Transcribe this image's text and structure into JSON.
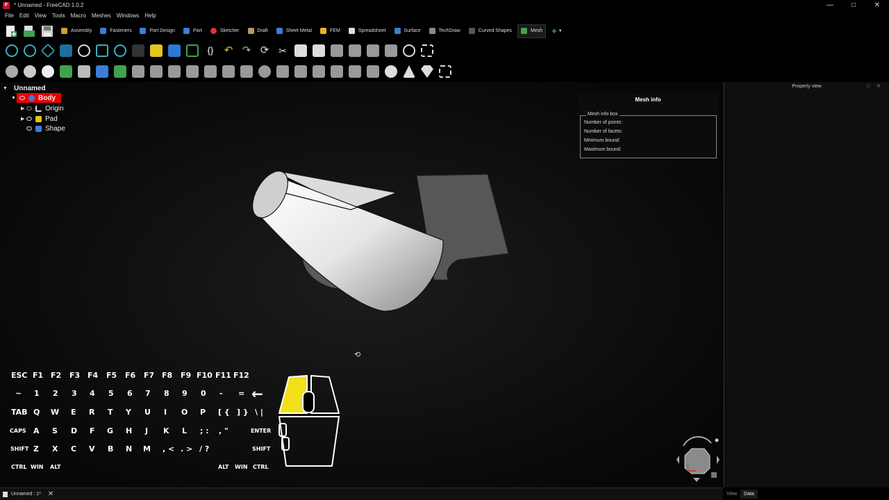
{
  "window": {
    "title": "* Unnamed - FreeCAD 1.0.2",
    "controls": [
      "—",
      "□",
      "✕"
    ]
  },
  "menu": [
    "File",
    "Edit",
    "View",
    "Tools",
    "Macro",
    "Meshes",
    "Windows",
    "Help"
  ],
  "workbenches": [
    {
      "label": "Assembly",
      "color": "#c9a227"
    },
    {
      "label": "Fasteners",
      "color": "#3b7dd8"
    },
    {
      "label": "Part Design",
      "color": "#3b7dd8"
    },
    {
      "label": "Part",
      "color": "#3b7dd8"
    },
    {
      "label": "Sketcher",
      "color": "#d33"
    },
    {
      "label": "Draft",
      "color": "#b89660"
    },
    {
      "label": "Sheet Metal",
      "color": "#3b7dd8"
    },
    {
      "label": "FEM",
      "color": "#e6b422"
    },
    {
      "label": "Spreadsheet",
      "color": "#ddd"
    },
    {
      "label": "Surface",
      "color": "#3b7dd8"
    },
    {
      "label": "TechDraw",
      "color": "#888"
    },
    {
      "label": "Curved Shapes",
      "color": "#555"
    },
    {
      "label": "Mesh",
      "color": "#3fa34d"
    }
  ],
  "active_workbench": "Mesh",
  "add_workbench_icon": "plus-icon",
  "tree": {
    "root": "Unnamed",
    "items": [
      {
        "label": "Body",
        "icon": "body-icon",
        "selected": true
      },
      {
        "label": "Origin",
        "icon": "origin-icon"
      },
      {
        "label": "Pad",
        "icon": "pad-icon"
      },
      {
        "label": "Shape",
        "icon": "shape-icon"
      }
    ]
  },
  "mesh_info": {
    "title": "Mesh info",
    "box_title": "Mesh info box",
    "lines": [
      "Number of points:",
      "Number of facets:",
      "Minimum bound:",
      "Maximum bound:"
    ]
  },
  "property_view": {
    "title": "Property view",
    "tabs": [
      "View",
      "Data"
    ],
    "active_tab": "Data"
  },
  "status": {
    "doc_tab": "Unnamed : 1*"
  },
  "keyboard": {
    "rows": [
      [
        "ESC",
        "F1",
        "F2",
        "F3",
        "F4",
        "F5",
        "F6",
        "F7",
        "F8",
        "F9",
        "F10",
        "F11",
        "F12"
      ],
      [
        "~",
        "1",
        "2",
        "3",
        "4",
        "5",
        "6",
        "7",
        "8",
        "9",
        "0",
        "-",
        "=",
        "←"
      ],
      [
        "TAB",
        "Q",
        "W",
        "E",
        "R",
        "T",
        "Y",
        "U",
        "I",
        "O",
        "P",
        "[ {",
        "] }",
        "\\ |"
      ],
      [
        "CAPS",
        "A",
        "S",
        "D",
        "F",
        "G",
        "H",
        "J",
        "K",
        "L",
        "; :",
        ", \""
      ],
      [
        "SHIFT",
        "Z",
        "X",
        "C",
        "V",
        "B",
        "N",
        "M",
        ", <",
        ". >",
        "/ ?",
        "SHIFT"
      ],
      [
        "CTRL",
        "WIN",
        "ALT",
        "ALT",
        "WIN",
        "CTRL"
      ]
    ],
    "enter": "ENTER",
    "highlight_color": "#f2e01a"
  },
  "colors": {
    "selection": "#ee0000",
    "mouse_highlight": "#f2e01a",
    "viewport_bg": "#000000"
  }
}
